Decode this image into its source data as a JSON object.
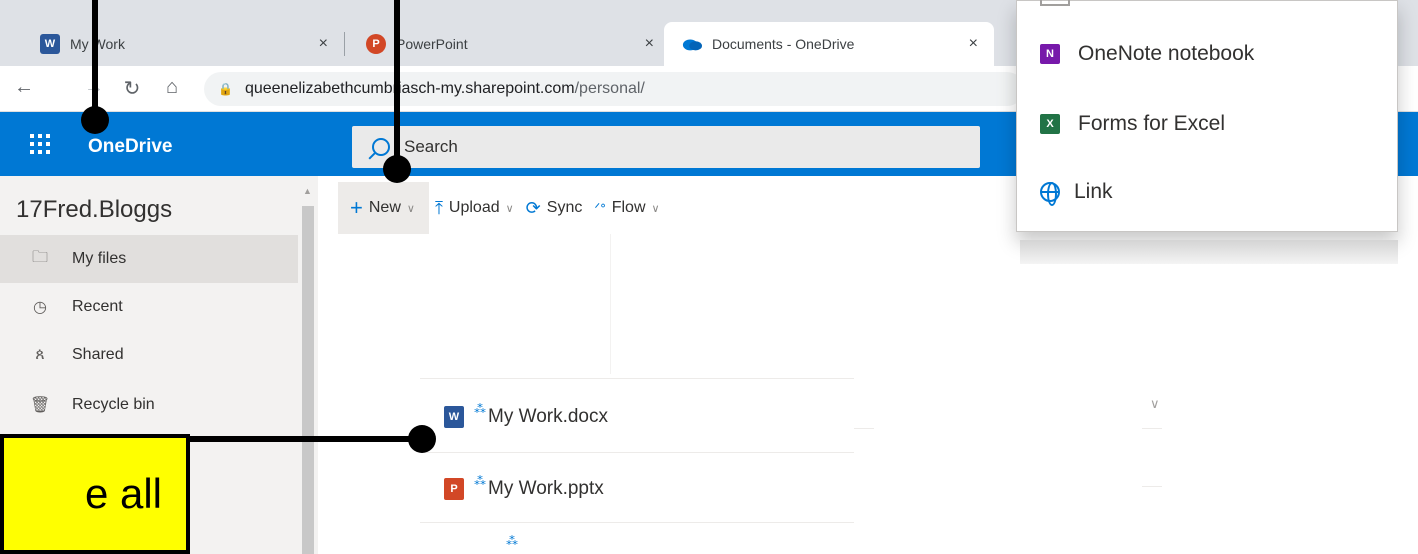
{
  "browser": {
    "tabs": [
      {
        "label": "My Work",
        "icon": "W",
        "icon_color": "#2b579a",
        "close": "×"
      },
      {
        "label": "PowerPoint",
        "icon": "P",
        "icon_color": "#d24726",
        "close": "×"
      },
      {
        "label": "Documents - OneDrive",
        "icon": "onedrive-cloud-icon",
        "icon_color": "#0078d4",
        "close": "×"
      }
    ],
    "url_host": "queenelizabethcumbriasch-my.sharepoint.com",
    "url_path": "/personal/"
  },
  "suite": {
    "app_name": "OneDrive",
    "search_placeholder": "Search",
    "brand_color": "#0078d4"
  },
  "nav": {
    "user": "17Fred.Bloggs",
    "items": [
      {
        "label": "My files",
        "icon": "folder-icon",
        "selected": true
      },
      {
        "label": "Recent",
        "icon": "clock-icon"
      },
      {
        "label": "Shared",
        "icon": "people-icon"
      },
      {
        "label": "Recycle bin",
        "icon": "recycle-bin-icon"
      }
    ]
  },
  "commands": {
    "new": "New",
    "upload": "Upload",
    "sync": "Sync",
    "flow": "Flow"
  },
  "files": [
    {
      "name": "My Work.docx",
      "type": "W",
      "color": "#2b579a"
    },
    {
      "name": "My Work.pptx",
      "type": "P",
      "color": "#d24726"
    }
  ],
  "new_menu": {
    "items": [
      {
        "label": "OneNote notebook",
        "icon": "N",
        "color": "#7719aa"
      },
      {
        "label": "Forms for Excel",
        "icon": "X",
        "color": "#217346"
      },
      {
        "label": "Link",
        "icon": "globe-icon",
        "color": "#0078d4"
      }
    ]
  },
  "callout": {
    "text": "e all"
  }
}
